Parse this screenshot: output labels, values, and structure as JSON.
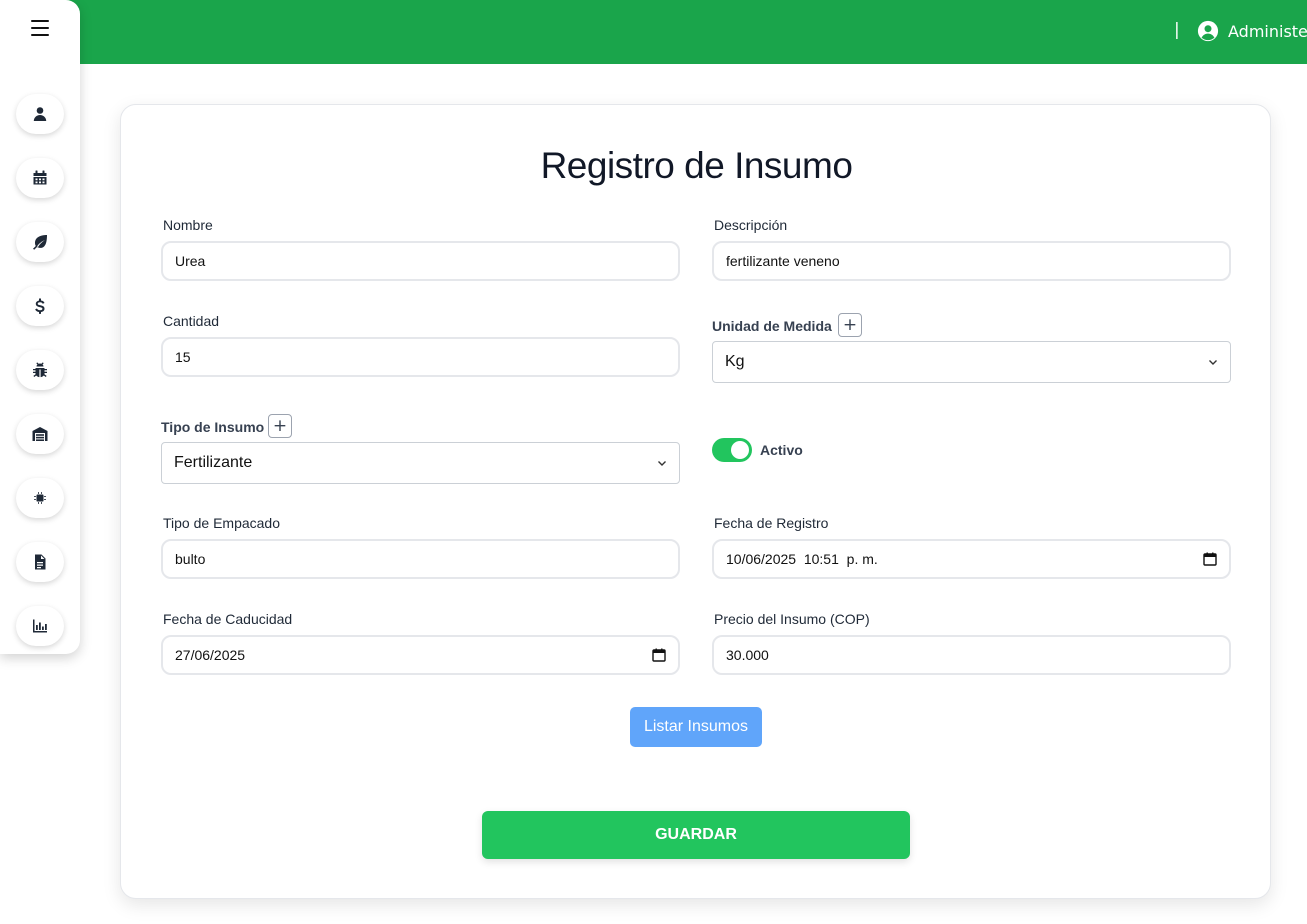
{
  "header": {
    "separator": "|",
    "user_label": "Administer"
  },
  "sidebar": {
    "items": [
      {
        "icon": "user-icon"
      },
      {
        "icon": "calendar-icon"
      },
      {
        "icon": "leaf-icon"
      },
      {
        "icon": "dollar-icon"
      },
      {
        "icon": "bug-icon"
      },
      {
        "icon": "warehouse-icon"
      },
      {
        "icon": "microchip-icon"
      },
      {
        "icon": "document-icon"
      },
      {
        "icon": "chart-icon"
      }
    ]
  },
  "form": {
    "title": "Registro de Insumo",
    "nombre": {
      "label": "Nombre",
      "value": "Urea"
    },
    "descripcion": {
      "label": "Descripción",
      "value": "fertilizante veneno"
    },
    "cantidad": {
      "label": "Cantidad",
      "value": "15"
    },
    "unidad": {
      "label": "Unidad de Medida",
      "value": "Kg",
      "add": "+"
    },
    "tipo_insumo": {
      "label": "Tipo de Insumo",
      "value": "Fertilizante",
      "add": "+"
    },
    "activo": {
      "label": "Activo",
      "checked": true
    },
    "tipo_empacado": {
      "label": "Tipo de Empacado",
      "value": "bulto"
    },
    "fecha_registro": {
      "label": "Fecha de Registro",
      "value": "10/06/2025  10:51  p. m."
    },
    "fecha_caducidad": {
      "label": "Fecha de Caducidad",
      "value": "27/06/2025"
    },
    "precio": {
      "label": "Precio del Insumo (COP)",
      "value": "30.000"
    },
    "list_button": "Listar Insumos",
    "save_button": "GUARDAR"
  },
  "colors": {
    "header": "#1aa54b",
    "accent_green": "#22c55e",
    "list_button": "#60a5fa"
  }
}
